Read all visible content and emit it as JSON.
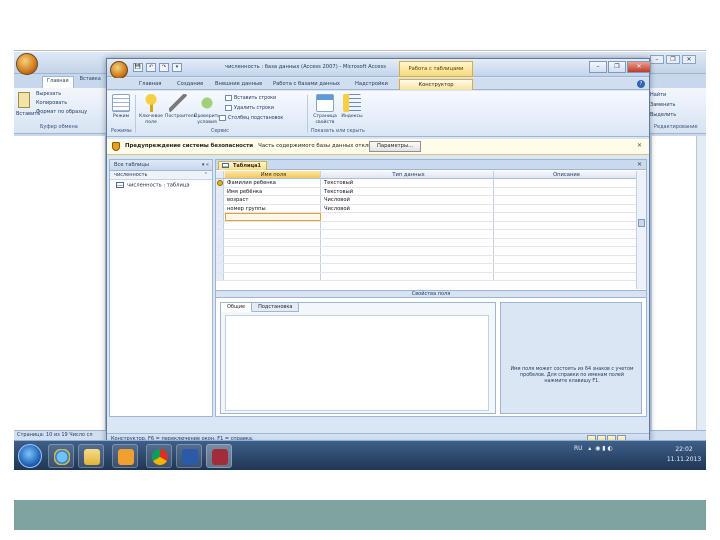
{
  "word": {
    "tabs": [
      "Главная",
      "Вставка"
    ],
    "clipboard": {
      "paste_label": "Вставить",
      "cut_label": "Вырезать",
      "copy_label": "Копировать",
      "format_label": "Формат по образцу",
      "group_label": "Буфер обмена"
    },
    "right_tools": {
      "find_label": "Найти",
      "replace_label": "Заменить",
      "select_label": "Выделить",
      "group_label": "Редактирование"
    },
    "status_text": "Страница: 10 из 19   Число сл",
    "win_buttons": [
      "–",
      "❐",
      "✕"
    ]
  },
  "access": {
    "title": "численность : база данных (Access 2007) - Microsoft Access",
    "context_title": "Работа с таблицами",
    "quick_access": [
      "💾",
      "↶",
      "↷",
      "▾"
    ],
    "win_buttons": [
      "–",
      "❐",
      "✕"
    ],
    "tabs": [
      "Главная",
      "Создание",
      "Внешние данные",
      "Работа с базами данных",
      "Надстройки",
      "Конструктор"
    ],
    "active_tab_index": 5,
    "ribbon": {
      "view_label": "Режим",
      "key_label": "Ключевое поле",
      "builder_label": "Построитель",
      "validate_label": "Проверить условия",
      "insert_rows": "Вставить строки",
      "delete_rows": "Удалить строки",
      "lookup_col": "Столбец подстановок",
      "prop_sheet": "Страница свойств",
      "indexes": "Индексы",
      "groups": [
        "Режимы",
        "Сервис",
        "Показать или скрыть"
      ]
    },
    "security": {
      "bold": "Предупреждение системы безопасности",
      "rest": "Часть содержимого базы данных отключена",
      "options_button": "Параметры..."
    },
    "nav": {
      "header": "Все таблицы",
      "group": "численность",
      "items": [
        "численность : таблица"
      ]
    },
    "doc_tab": "Таблица1",
    "grid": {
      "headers": [
        "Имя поля",
        "Тип данных",
        "Описание"
      ],
      "rows": [
        {
          "name": "Фамилия ребенка",
          "type": "Текстовый",
          "desc": ""
        },
        {
          "name": "Имя ребёнка",
          "type": "Текстовый",
          "desc": ""
        },
        {
          "name": "возраст",
          "type": "Числовой",
          "desc": ""
        },
        {
          "name": "номер группы",
          "type": "Числовой",
          "desc": ""
        }
      ]
    },
    "props_bar": "Свойства поля",
    "props_tabs": [
      "Общие",
      "Подстановка"
    ],
    "props_help": "Имя поля может состоять из 64 знаков с учетом пробелов. Для справки по именам полей нажмите клавишу F1.",
    "status": "Конструктор.  F6 = переключение окон.  F1 = справка."
  },
  "taskbar": {
    "tray_lang": "RU",
    "clock_time": "22:02",
    "clock_date": "11.11.2013"
  }
}
